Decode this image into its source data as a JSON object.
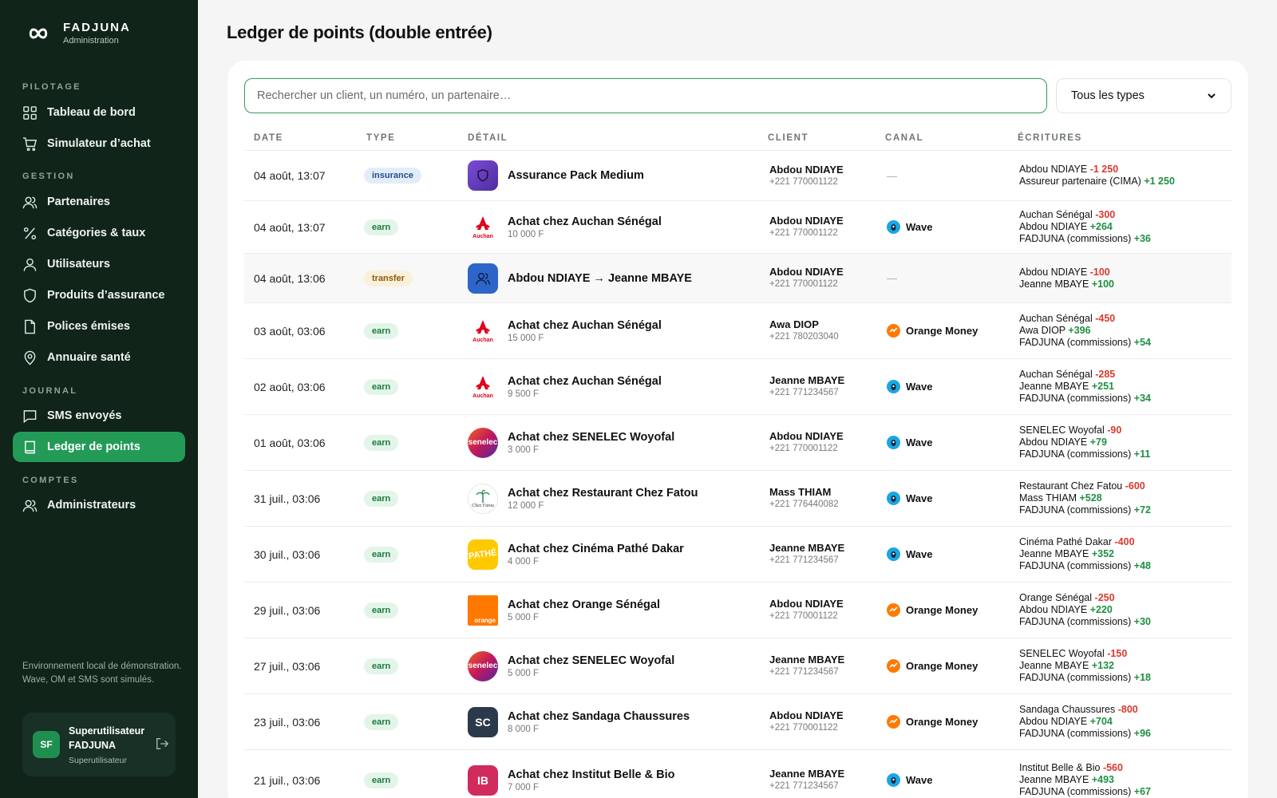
{
  "brand": {
    "name": "FADJUNA",
    "subtitle": "Administration"
  },
  "sidebar": {
    "sections": [
      "PILOTAGE",
      "GESTION",
      "JOURNAL",
      "COMPTES"
    ],
    "items": [
      {
        "label": "Tableau de bord",
        "icon": "grid-icon"
      },
      {
        "label": "Simulateur d’achat",
        "icon": "cart-icon"
      },
      {
        "label": "Partenaires",
        "icon": "users-icon"
      },
      {
        "label": "Catégories & taux",
        "icon": "percent-icon"
      },
      {
        "label": "Utilisateurs",
        "icon": "user-icon"
      },
      {
        "label": "Produits d’assurance",
        "icon": "shield-icon"
      },
      {
        "label": "Polices émises",
        "icon": "file-icon"
      },
      {
        "label": "Annuaire santé",
        "icon": "location-pin-icon"
      },
      {
        "label": "SMS envoyés",
        "icon": "message-icon"
      },
      {
        "label": "Ledger de points",
        "icon": "book-icon",
        "active": true
      },
      {
        "label": "Administrateurs",
        "icon": "users-icon"
      }
    ],
    "env_note": "Environnement local de démonstration. Wave, OM et SMS sont simulés.",
    "user": {
      "initials": "SF",
      "name": "Superutilisateur FADJUNA",
      "role": "Superutilisateur"
    }
  },
  "main": {
    "title": "Ledger de points (double entrée)",
    "search": {
      "placeholder": "Rechercher un client, un numéro, un partenaire…",
      "value": ""
    },
    "type_filter": {
      "selected": "Tous les types"
    },
    "columns": [
      "DATE",
      "TYPE",
      "DÉTAIL",
      "CLIENT",
      "CANAL",
      "ÉCRITURES"
    ],
    "rows": [
      {
        "date": "04 août, 13:07",
        "type": "insurance",
        "logo": "shield-icon",
        "title": "Assurance Pack Medium",
        "amount": "",
        "client": "Abdou NDIAYE",
        "phone": "+221 770001122",
        "canal": "—",
        "entries": [
          {
            "who": "Abdou NDIAYE",
            "pts": "-1 250"
          },
          {
            "who": "Assureur partenaire (CIMA)",
            "pts": "+1 250"
          }
        ]
      },
      {
        "date": "04 août, 13:07",
        "type": "earn",
        "logo": "auchan-logo",
        "title": "Achat chez Auchan Sénégal",
        "amount": "10 000 F",
        "client": "Abdou NDIAYE",
        "phone": "+221 770001122",
        "canal": "Wave",
        "entries": [
          {
            "who": "Auchan Sénégal",
            "pts": "-300"
          },
          {
            "who": "Abdou NDIAYE",
            "pts": "+264"
          },
          {
            "who": "FADJUNA (commissions)",
            "pts": "+36"
          }
        ]
      },
      {
        "date": "04 août, 13:06",
        "type": "transfer",
        "logo": "users-icon",
        "title": "Abdou NDIAYE → Jeanne MBAYE",
        "amount": "",
        "client": "Abdou NDIAYE",
        "phone": "+221 770001122",
        "canal": "—",
        "entries": [
          {
            "who": "Abdou NDIAYE",
            "pts": "-100"
          },
          {
            "who": "Jeanne MBAYE",
            "pts": "+100"
          }
        ]
      },
      {
        "date": "03 août, 03:06",
        "type": "earn",
        "logo": "auchan-logo",
        "title": "Achat chez Auchan Sénégal",
        "amount": "15 000 F",
        "client": "Awa DIOP",
        "phone": "+221 780203040",
        "canal": "Orange Money",
        "entries": [
          {
            "who": "Auchan Sénégal",
            "pts": "-450"
          },
          {
            "who": "Awa DIOP",
            "pts": "+396"
          },
          {
            "who": "FADJUNA (commissions)",
            "pts": "+54"
          }
        ]
      },
      {
        "date": "02 août, 03:06",
        "type": "earn",
        "logo": "auchan-logo",
        "title": "Achat chez Auchan Sénégal",
        "amount": "9 500 F",
        "client": "Jeanne MBAYE",
        "phone": "+221 771234567",
        "canal": "Wave",
        "entries": [
          {
            "who": "Auchan Sénégal",
            "pts": "-285"
          },
          {
            "who": "Jeanne MBAYE",
            "pts": "+251"
          },
          {
            "who": "FADJUNA (commissions)",
            "pts": "+34"
          }
        ]
      },
      {
        "date": "01 août, 03:06",
        "type": "earn",
        "logo": "senelec-logo",
        "title": "Achat chez SENELEC Woyofal",
        "amount": "3 000 F",
        "client": "Abdou NDIAYE",
        "phone": "+221 770001122",
        "canal": "Wave",
        "entries": [
          {
            "who": "SENELEC Woyofal",
            "pts": "-90"
          },
          {
            "who": "Abdou NDIAYE",
            "pts": "+79"
          },
          {
            "who": "FADJUNA (commissions)",
            "pts": "+11"
          }
        ]
      },
      {
        "date": "31 juil., 03:06",
        "type": "earn",
        "logo": "chez-fatou-logo",
        "title": "Achat chez Restaurant Chez Fatou",
        "amount": "12 000 F",
        "client": "Mass THIAM",
        "phone": "+221 776440082",
        "canal": "Wave",
        "entries": [
          {
            "who": "Restaurant Chez Fatou",
            "pts": "-600"
          },
          {
            "who": "Mass THIAM",
            "pts": "+528"
          },
          {
            "who": "FADJUNA (commissions)",
            "pts": "+72"
          }
        ]
      },
      {
        "date": "30 juil., 03:06",
        "type": "earn",
        "logo": "pathe-logo",
        "title": "Achat chez Cinéma Pathé Dakar",
        "amount": "4 000 F",
        "client": "Jeanne MBAYE",
        "phone": "+221 771234567",
        "canal": "Wave",
        "entries": [
          {
            "who": "Cinéma Pathé Dakar",
            "pts": "-400"
          },
          {
            "who": "Jeanne MBAYE",
            "pts": "+352"
          },
          {
            "who": "FADJUNA (commissions)",
            "pts": "+48"
          }
        ]
      },
      {
        "date": "29 juil., 03:06",
        "type": "earn",
        "logo": "orange-logo",
        "title": "Achat chez Orange Sénégal",
        "amount": "5 000 F",
        "client": "Abdou NDIAYE",
        "phone": "+221 770001122",
        "canal": "Orange Money",
        "entries": [
          {
            "who": "Orange Sénégal",
            "pts": "-250"
          },
          {
            "who": "Abdou NDIAYE",
            "pts": "+220"
          },
          {
            "who": "FADJUNA (commissions)",
            "pts": "+30"
          }
        ]
      },
      {
        "date": "27 juil., 03:06",
        "type": "earn",
        "logo": "senelec-logo",
        "title": "Achat chez SENELEC Woyofal",
        "amount": "5 000 F",
        "client": "Jeanne MBAYE",
        "phone": "+221 771234567",
        "canal": "Orange Money",
        "entries": [
          {
            "who": "SENELEC Woyofal",
            "pts": "-150"
          },
          {
            "who": "Jeanne MBAYE",
            "pts": "+132"
          },
          {
            "who": "FADJUNA (commissions)",
            "pts": "+18"
          }
        ]
      },
      {
        "date": "23 juil., 03:06",
        "type": "earn",
        "logo": "initials-logo",
        "initials": "SC",
        "title": "Achat chez Sandaga Chaussures",
        "amount": "8 000 F",
        "client": "Abdou NDIAYE",
        "phone": "+221 770001122",
        "canal": "Orange Money",
        "entries": [
          {
            "who": "Sandaga Chaussures",
            "pts": "-800"
          },
          {
            "who": "Abdou NDIAYE",
            "pts": "+704"
          },
          {
            "who": "FADJUNA (commissions)",
            "pts": "+96"
          }
        ]
      },
      {
        "date": "21 juil., 03:06",
        "type": "earn",
        "logo": "initials-logo",
        "initials": "IB",
        "title": "Achat chez Institut Belle & Bio",
        "amount": "7 000 F",
        "client": "Jeanne MBAYE",
        "phone": "+221 771234567",
        "canal": "Wave",
        "entries": [
          {
            "who": "Institut Belle & Bio",
            "pts": "-560"
          },
          {
            "who": "Jeanne MBAYE",
            "pts": "+493"
          },
          {
            "who": "FADJUNA (commissions)",
            "pts": "+67"
          }
        ]
      }
    ]
  },
  "colors": {
    "sidebar_bg": "#10241a",
    "accent": "#239b57",
    "negative": "#d83a2e",
    "positive": "#1f8f43",
    "wave": "#1ba5e3",
    "orange_money": "#ff7a00"
  }
}
